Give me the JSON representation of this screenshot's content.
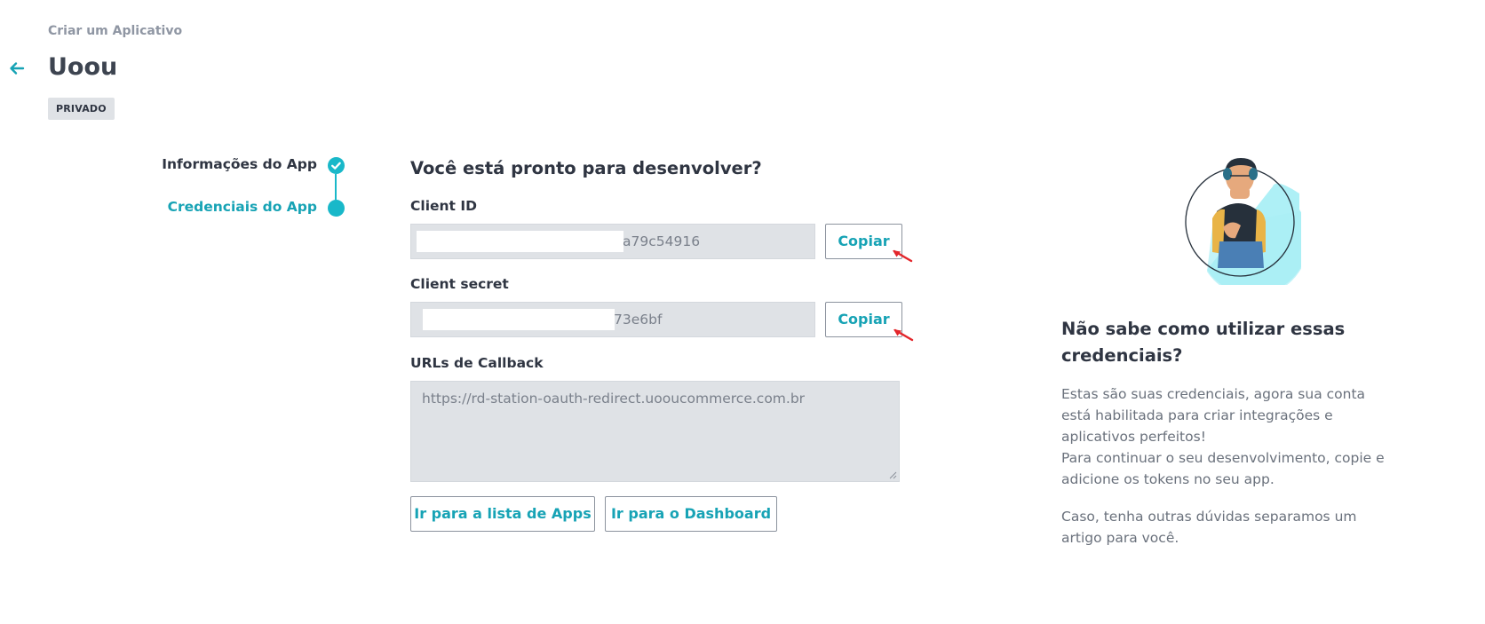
{
  "header": {
    "breadcrumb": "Criar um Aplicativo",
    "title": "Uoou",
    "badge": "PRIVADO"
  },
  "stepper": {
    "steps": [
      {
        "label": "Informações do App",
        "state": "completed"
      },
      {
        "label": "Credenciais do App",
        "state": "current"
      }
    ]
  },
  "main": {
    "title": "Você está pronto para desenvolver?",
    "client_id": {
      "label": "Client ID",
      "visible_value": "a79c54916",
      "copy_label": "Copiar"
    },
    "client_secret": {
      "label": "Client secret",
      "visible_value": "73e6bf",
      "copy_label": "Copiar"
    },
    "callback": {
      "label": "URLs de Callback",
      "value": "https://rd-station-oauth-redirect.uooucommerce.com.br"
    },
    "buttons": {
      "apps": "Ir para a lista de Apps",
      "dashboard": "Ir para o Dashboard"
    }
  },
  "aside": {
    "title": "Não sabe como utilizar essas credenciais?",
    "paragraph1": "Estas são suas credenciais, agora sua conta está habilitada para criar integrações e aplicativos perfeitos!",
    "paragraph2": "Para continuar o seu desenvolvimento, copie e adicione os tokens no seu app.",
    "paragraph3": "Caso, tenha outras dúvidas separamos um artigo para você."
  },
  "colors": {
    "accent": "#19b8c9",
    "accent_text": "#17a3b5",
    "input_bg": "#dfe2e6",
    "annotation_arrow": "#e3262b"
  },
  "icons": {
    "back": "arrow-left-icon",
    "step_done": "check-circle-icon",
    "step_current": "dot-icon",
    "annotation": "red-arrow-icon"
  }
}
